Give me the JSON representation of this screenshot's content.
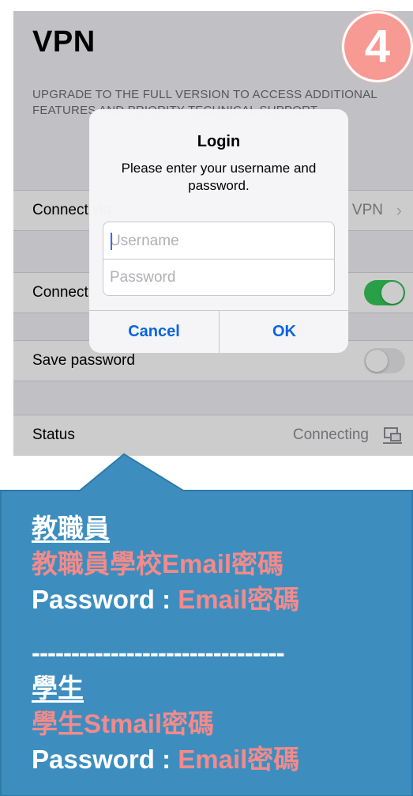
{
  "screen": {
    "title": "VPN",
    "upgrade_text": "UPGRADE TO THE FULL VERSION TO ACCESS ADDITIONAL FEATURES AND PRIORITY TECHNICAL SUPPORT",
    "rows": {
      "connect_via_label": "Connect via",
      "connect_via_value": "VPN",
      "connect_label": "Connect",
      "connect_on": true,
      "save_password_label": "Save password",
      "save_password_on": false,
      "status_label": "Status",
      "status_value": "Connecting"
    }
  },
  "dialog": {
    "title": "Login",
    "message": "Please enter your username and password.",
    "username_placeholder": "Username",
    "password_placeholder": "Password",
    "cancel_label": "Cancel",
    "ok_label": "OK"
  },
  "step_badge": "4",
  "callout": {
    "staff_heading": "教職員",
    "staff_note": "教職員學校Email密碼",
    "staff_password_prefix": "Password : ",
    "staff_password_value": "Email密碼",
    "divider": "--------------------------------",
    "student_heading": "學生",
    "student_note": "學生Stmail密碼",
    "student_password_prefix": "Password : ",
    "student_password_value": "Email密碼"
  },
  "colors": {
    "callout_bg": "#3d8ebf",
    "callout_border": "#2f7aa6",
    "badge_bg": "#f79a94",
    "accent_text": "#f48a8a",
    "ios_blue": "#0a64e0",
    "toggle_on": "#34c759"
  }
}
